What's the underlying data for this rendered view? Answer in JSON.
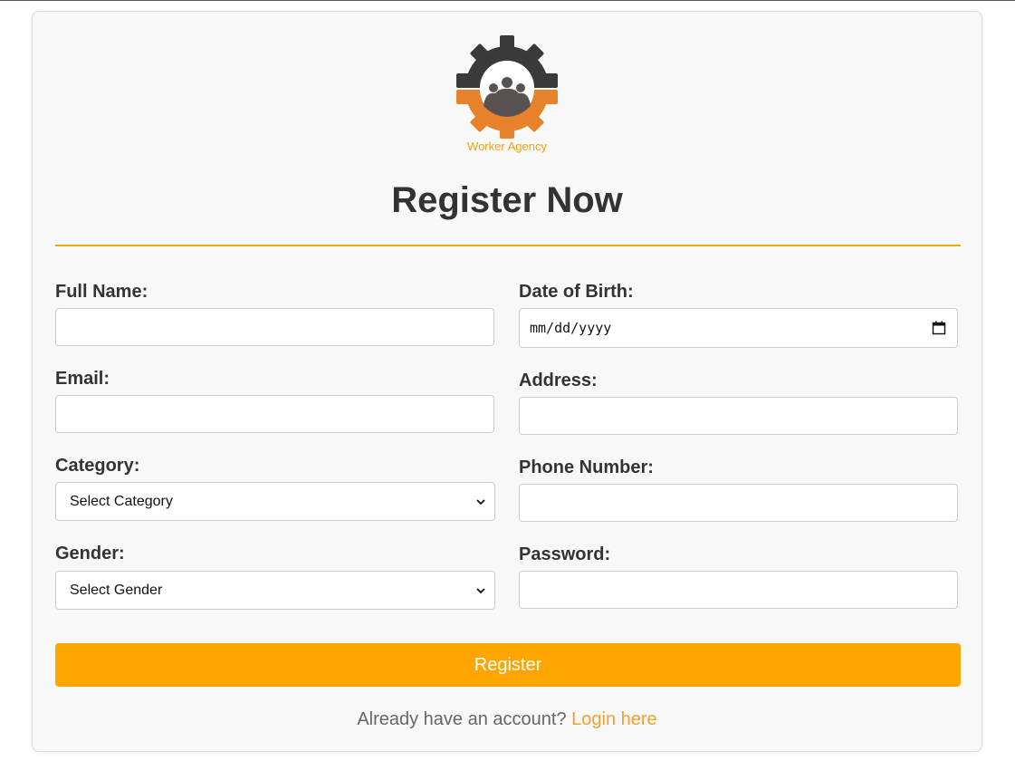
{
  "brand": {
    "logo_text": "Worker Agency",
    "accent_color": "#ffa500",
    "logo_icon": "gear-people-icon"
  },
  "form": {
    "title": "Register Now",
    "fields": {
      "full_name": {
        "label": "Full Name:",
        "value": ""
      },
      "email": {
        "label": "Email:",
        "value": ""
      },
      "category": {
        "label": "Category:",
        "selected": "Select Category"
      },
      "gender": {
        "label": "Gender:",
        "selected": "Select Gender"
      },
      "dob": {
        "label": "Date of Birth:",
        "placeholder": "mm/dd/yyyy"
      },
      "address": {
        "label": "Address:",
        "value": ""
      },
      "phone": {
        "label": "Phone Number:",
        "value": ""
      },
      "password": {
        "label": "Password:",
        "value": ""
      }
    },
    "submit_label": "Register",
    "login_prompt": "Already have an account?",
    "login_link": "Login here"
  }
}
